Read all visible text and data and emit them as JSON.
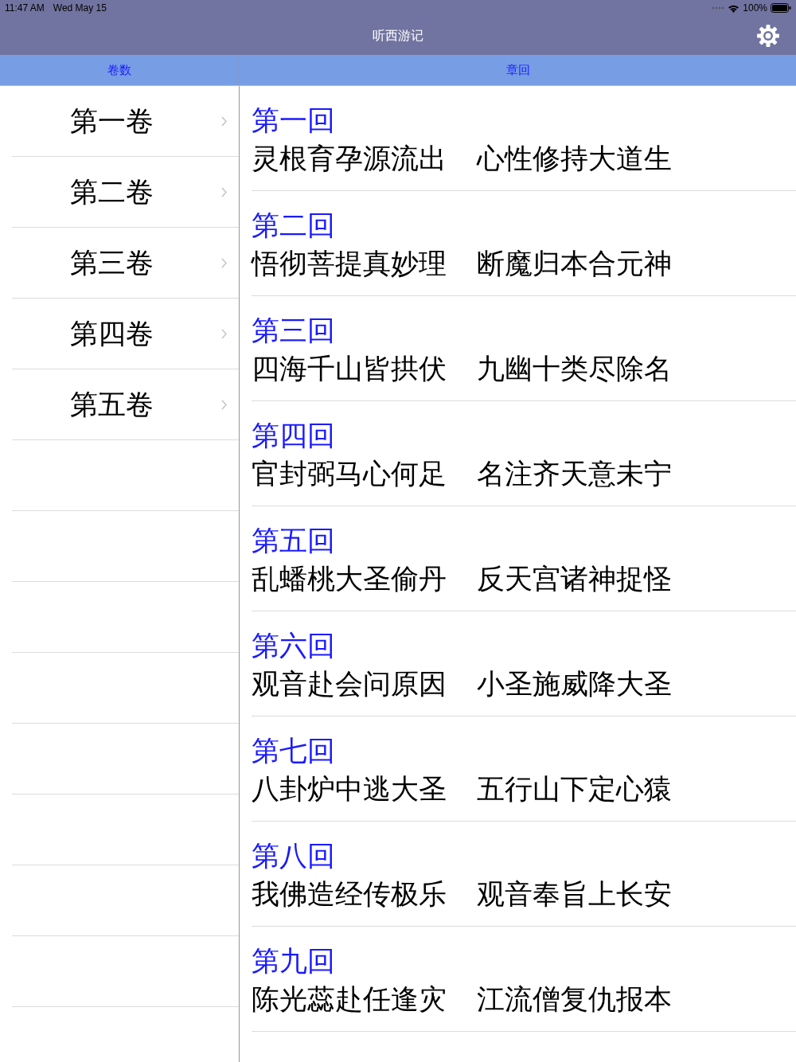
{
  "status_bar": {
    "time": "11:47 AM",
    "date": "Wed May 15",
    "battery": "100%"
  },
  "nav_bar": {
    "title": "听西游记"
  },
  "columns": [
    {
      "label": "卷数"
    },
    {
      "label": "章回"
    }
  ],
  "volumes": [
    {
      "label": "第一卷"
    },
    {
      "label": "第二卷"
    },
    {
      "label": "第三卷"
    },
    {
      "label": "第四卷"
    },
    {
      "label": "第五卷"
    }
  ],
  "chapters": [
    {
      "title": "第一回",
      "line_1": "灵根育孕源流出",
      "line_2": "心性修持大道生"
    },
    {
      "title": "第二回",
      "line_1": "悟彻菩提真妙理",
      "line_2": "断魔归本合元神"
    },
    {
      "title": "第三回",
      "line_1": "四海千山皆拱伏",
      "line_2": "九幽十类尽除名"
    },
    {
      "title": "第四回",
      "line_1": "官封弼马心何足",
      "line_2": "名注齐天意未宁"
    },
    {
      "title": "第五回",
      "line_1": "乱蟠桃大圣偷丹",
      "line_2": "反天宫诸神捉怪"
    },
    {
      "title": "第六回",
      "line_1": "观音赴会问原因",
      "line_2": "小圣施威降大圣"
    },
    {
      "title": "第七回",
      "line_1": "八卦炉中逃大圣",
      "line_2": "五行山下定心猿"
    },
    {
      "title": "第八回",
      "line_1": "我佛造经传极乐",
      "line_2": "观音奉旨上长安"
    },
    {
      "title": "第九回",
      "line_1": "陈光蕊赴任逢灾",
      "line_2": "江流僧复仇报本"
    }
  ]
}
